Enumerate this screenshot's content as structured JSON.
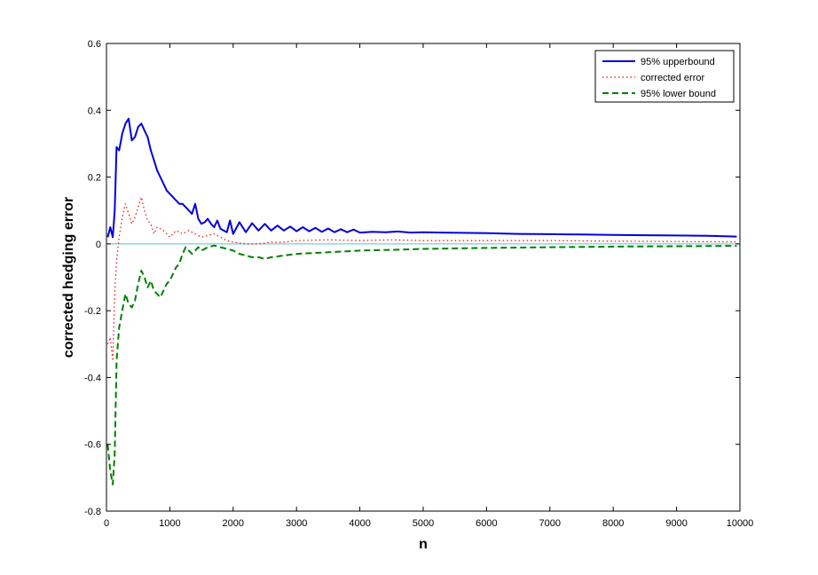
{
  "chart_data": {
    "type": "line",
    "xlabel": "n",
    "ylabel": "corrected hedging error",
    "xlim": [
      0,
      10000
    ],
    "ylim": [
      -0.8,
      0.6
    ],
    "xticks": [
      0,
      1000,
      2000,
      3000,
      4000,
      5000,
      6000,
      7000,
      8000,
      9000,
      10000
    ],
    "xtick_labels": [
      "0",
      "1000",
      "2000",
      "3000",
      "4000",
      "5000",
      "6000",
      "7000",
      "8000",
      "9000",
      "10000"
    ],
    "yticks": [
      -0.8,
      -0.6,
      -0.4,
      -0.2,
      0,
      0.2,
      0.4,
      0.6
    ],
    "ytick_labels": [
      "-0.8",
      "-0.6",
      "-0.4",
      "-0.2",
      "0",
      "0.2",
      "0.4",
      "0.6"
    ],
    "grid": false,
    "legend_position": "top-right",
    "reference_line": {
      "y": 0,
      "color": "#4dc8c8"
    },
    "series": [
      {
        "name": "95% upperbound",
        "color": "#0000dd",
        "style": "solid",
        "x": [
          20,
          60,
          100,
          130,
          160,
          200,
          250,
          300,
          350,
          400,
          450,
          500,
          550,
          600,
          650,
          700,
          750,
          800,
          850,
          900,
          950,
          1000,
          1050,
          1100,
          1150,
          1200,
          1250,
          1300,
          1350,
          1400,
          1450,
          1500,
          1550,
          1600,
          1650,
          1700,
          1750,
          1800,
          1850,
          1900,
          1950,
          2000,
          2100,
          2200,
          2300,
          2400,
          2500,
          2600,
          2700,
          2800,
          2900,
          3000,
          3100,
          3200,
          3300,
          3400,
          3500,
          3600,
          3700,
          3800,
          3900,
          4000,
          4200,
          4400,
          4600,
          4800,
          5000,
          5300,
          5600,
          6000,
          6500,
          7000,
          7500,
          8000,
          8500,
          9000,
          9500,
          9950
        ],
        "y": [
          0.02,
          0.05,
          0.02,
          0.1,
          0.29,
          0.28,
          0.33,
          0.36,
          0.375,
          0.31,
          0.32,
          0.35,
          0.36,
          0.34,
          0.32,
          0.28,
          0.25,
          0.22,
          0.2,
          0.18,
          0.16,
          0.15,
          0.14,
          0.13,
          0.12,
          0.12,
          0.11,
          0.1,
          0.09,
          0.12,
          0.075,
          0.06,
          0.065,
          0.075,
          0.06,
          0.05,
          0.07,
          0.045,
          0.04,
          0.035,
          0.07,
          0.03,
          0.065,
          0.035,
          0.062,
          0.04,
          0.06,
          0.04,
          0.055,
          0.04,
          0.052,
          0.038,
          0.05,
          0.038,
          0.048,
          0.036,
          0.046,
          0.035,
          0.044,
          0.035,
          0.043,
          0.034,
          0.036,
          0.035,
          0.037,
          0.034,
          0.035,
          0.034,
          0.033,
          0.032,
          0.03,
          0.029,
          0.028,
          0.027,
          0.026,
          0.025,
          0.024,
          0.022
        ]
      },
      {
        "name": "corrected error",
        "color": "#ff0000",
        "style": "dotted",
        "x": [
          20,
          60,
          100,
          130,
          160,
          200,
          250,
          300,
          350,
          400,
          450,
          500,
          550,
          600,
          650,
          700,
          750,
          800,
          900,
          1000,
          1100,
          1200,
          1300,
          1400,
          1500,
          1600,
          1700,
          1800,
          1900,
          2000,
          2200,
          2400,
          2600,
          2800,
          3000,
          3500,
          4000,
          4500,
          5000,
          6000,
          7000,
          8000,
          9000,
          9950
        ],
        "y": [
          -0.3,
          -0.28,
          -0.35,
          -0.15,
          -0.05,
          0.02,
          0.08,
          0.12,
          0.09,
          0.06,
          0.08,
          0.11,
          0.14,
          0.1,
          0.07,
          0.06,
          0.03,
          0.05,
          0.04,
          0.02,
          0.04,
          0.03,
          0.04,
          0.03,
          0.02,
          0.025,
          0.03,
          0.02,
          0.01,
          0.005,
          0.0,
          0.0,
          0.005,
          0.005,
          0.01,
          0.012,
          0.01,
          0.012,
          0.01,
          0.01,
          0.01,
          0.008,
          0.007,
          0.006
        ]
      },
      {
        "name": "95% lower bound",
        "color": "#008000",
        "style": "dashed",
        "x": [
          20,
          60,
          100,
          130,
          160,
          200,
          250,
          300,
          350,
          400,
          450,
          500,
          550,
          600,
          650,
          700,
          750,
          800,
          850,
          900,
          950,
          1000,
          1050,
          1100,
          1150,
          1200,
          1250,
          1300,
          1350,
          1400,
          1450,
          1500,
          1600,
          1700,
          1800,
          1900,
          2000,
          2100,
          2200,
          2300,
          2400,
          2500,
          2600,
          2800,
          3000,
          3200,
          3500,
          4000,
          4500,
          5000,
          6000,
          7000,
          8000,
          9000,
          9950
        ],
        "y": [
          -0.6,
          -0.68,
          -0.72,
          -0.63,
          -0.35,
          -0.25,
          -0.2,
          -0.15,
          -0.18,
          -0.19,
          -0.17,
          -0.12,
          -0.08,
          -0.1,
          -0.13,
          -0.11,
          -0.14,
          -0.15,
          -0.16,
          -0.14,
          -0.12,
          -0.11,
          -0.09,
          -0.07,
          -0.06,
          -0.03,
          -0.01,
          -0.02,
          -0.03,
          -0.02,
          -0.01,
          -0.02,
          -0.01,
          -0.005,
          -0.01,
          -0.015,
          -0.02,
          -0.03,
          -0.035,
          -0.04,
          -0.04,
          -0.045,
          -0.04,
          -0.035,
          -0.03,
          -0.028,
          -0.025,
          -0.02,
          -0.018,
          -0.015,
          -0.012,
          -0.01,
          -0.008,
          -0.007,
          -0.006
        ]
      }
    ]
  }
}
